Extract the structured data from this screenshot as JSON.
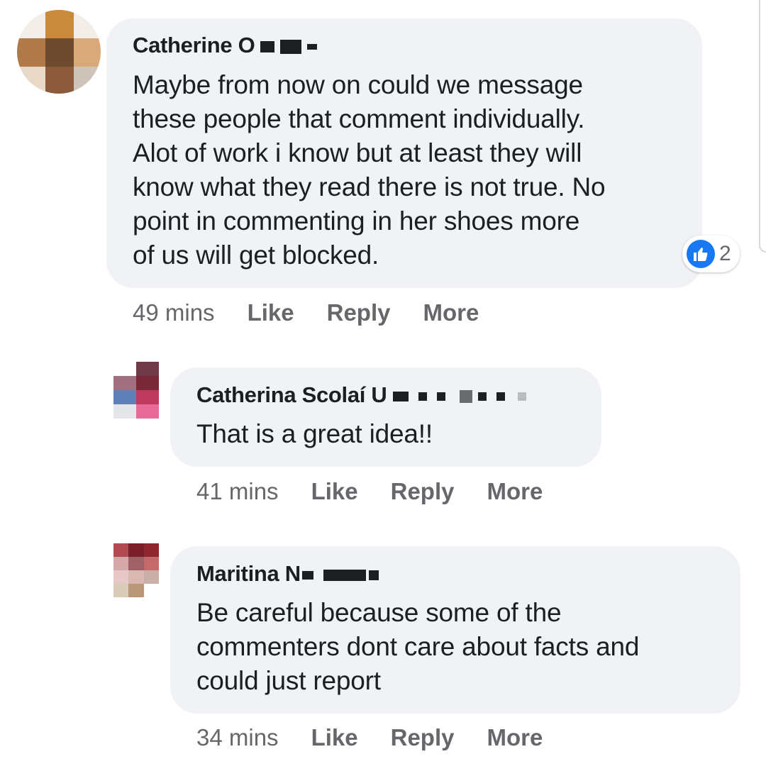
{
  "comments": [
    {
      "author_visible": "Catherine O",
      "text_lines": [
        "Maybe from now on could we message",
        "these people that comment individually.",
        "Alot of work i know but at least they will",
        "know what they read there is not true. No",
        "point in commenting in her shoes more",
        "of us will get blocked."
      ],
      "timestamp": "49 mins",
      "actions": {
        "like": "Like",
        "reply": "Reply",
        "more": "More"
      },
      "reaction": {
        "icon": "thumbs-up-icon",
        "count": "2",
        "color": "#1877f2"
      }
    },
    {
      "author_visible": "Catherina Scolaí U",
      "text_lines": [
        "That is a great idea!!"
      ],
      "timestamp": "41 mins",
      "actions": {
        "like": "Like",
        "reply": "Reply",
        "more": "More"
      }
    },
    {
      "author_visible": "Maritina N",
      "text_lines": [
        "Be careful because some of the",
        "commenters dont care about facts and",
        "could just report"
      ],
      "timestamp": "34 mins",
      "actions": {
        "like": "Like",
        "reply": "Reply",
        "more": "More"
      }
    }
  ],
  "colors": {
    "bubble_bg": "#f0f2f5",
    "text": "#1c1e21",
    "secondary_text": "#65676b",
    "like_blue": "#1877f2"
  }
}
